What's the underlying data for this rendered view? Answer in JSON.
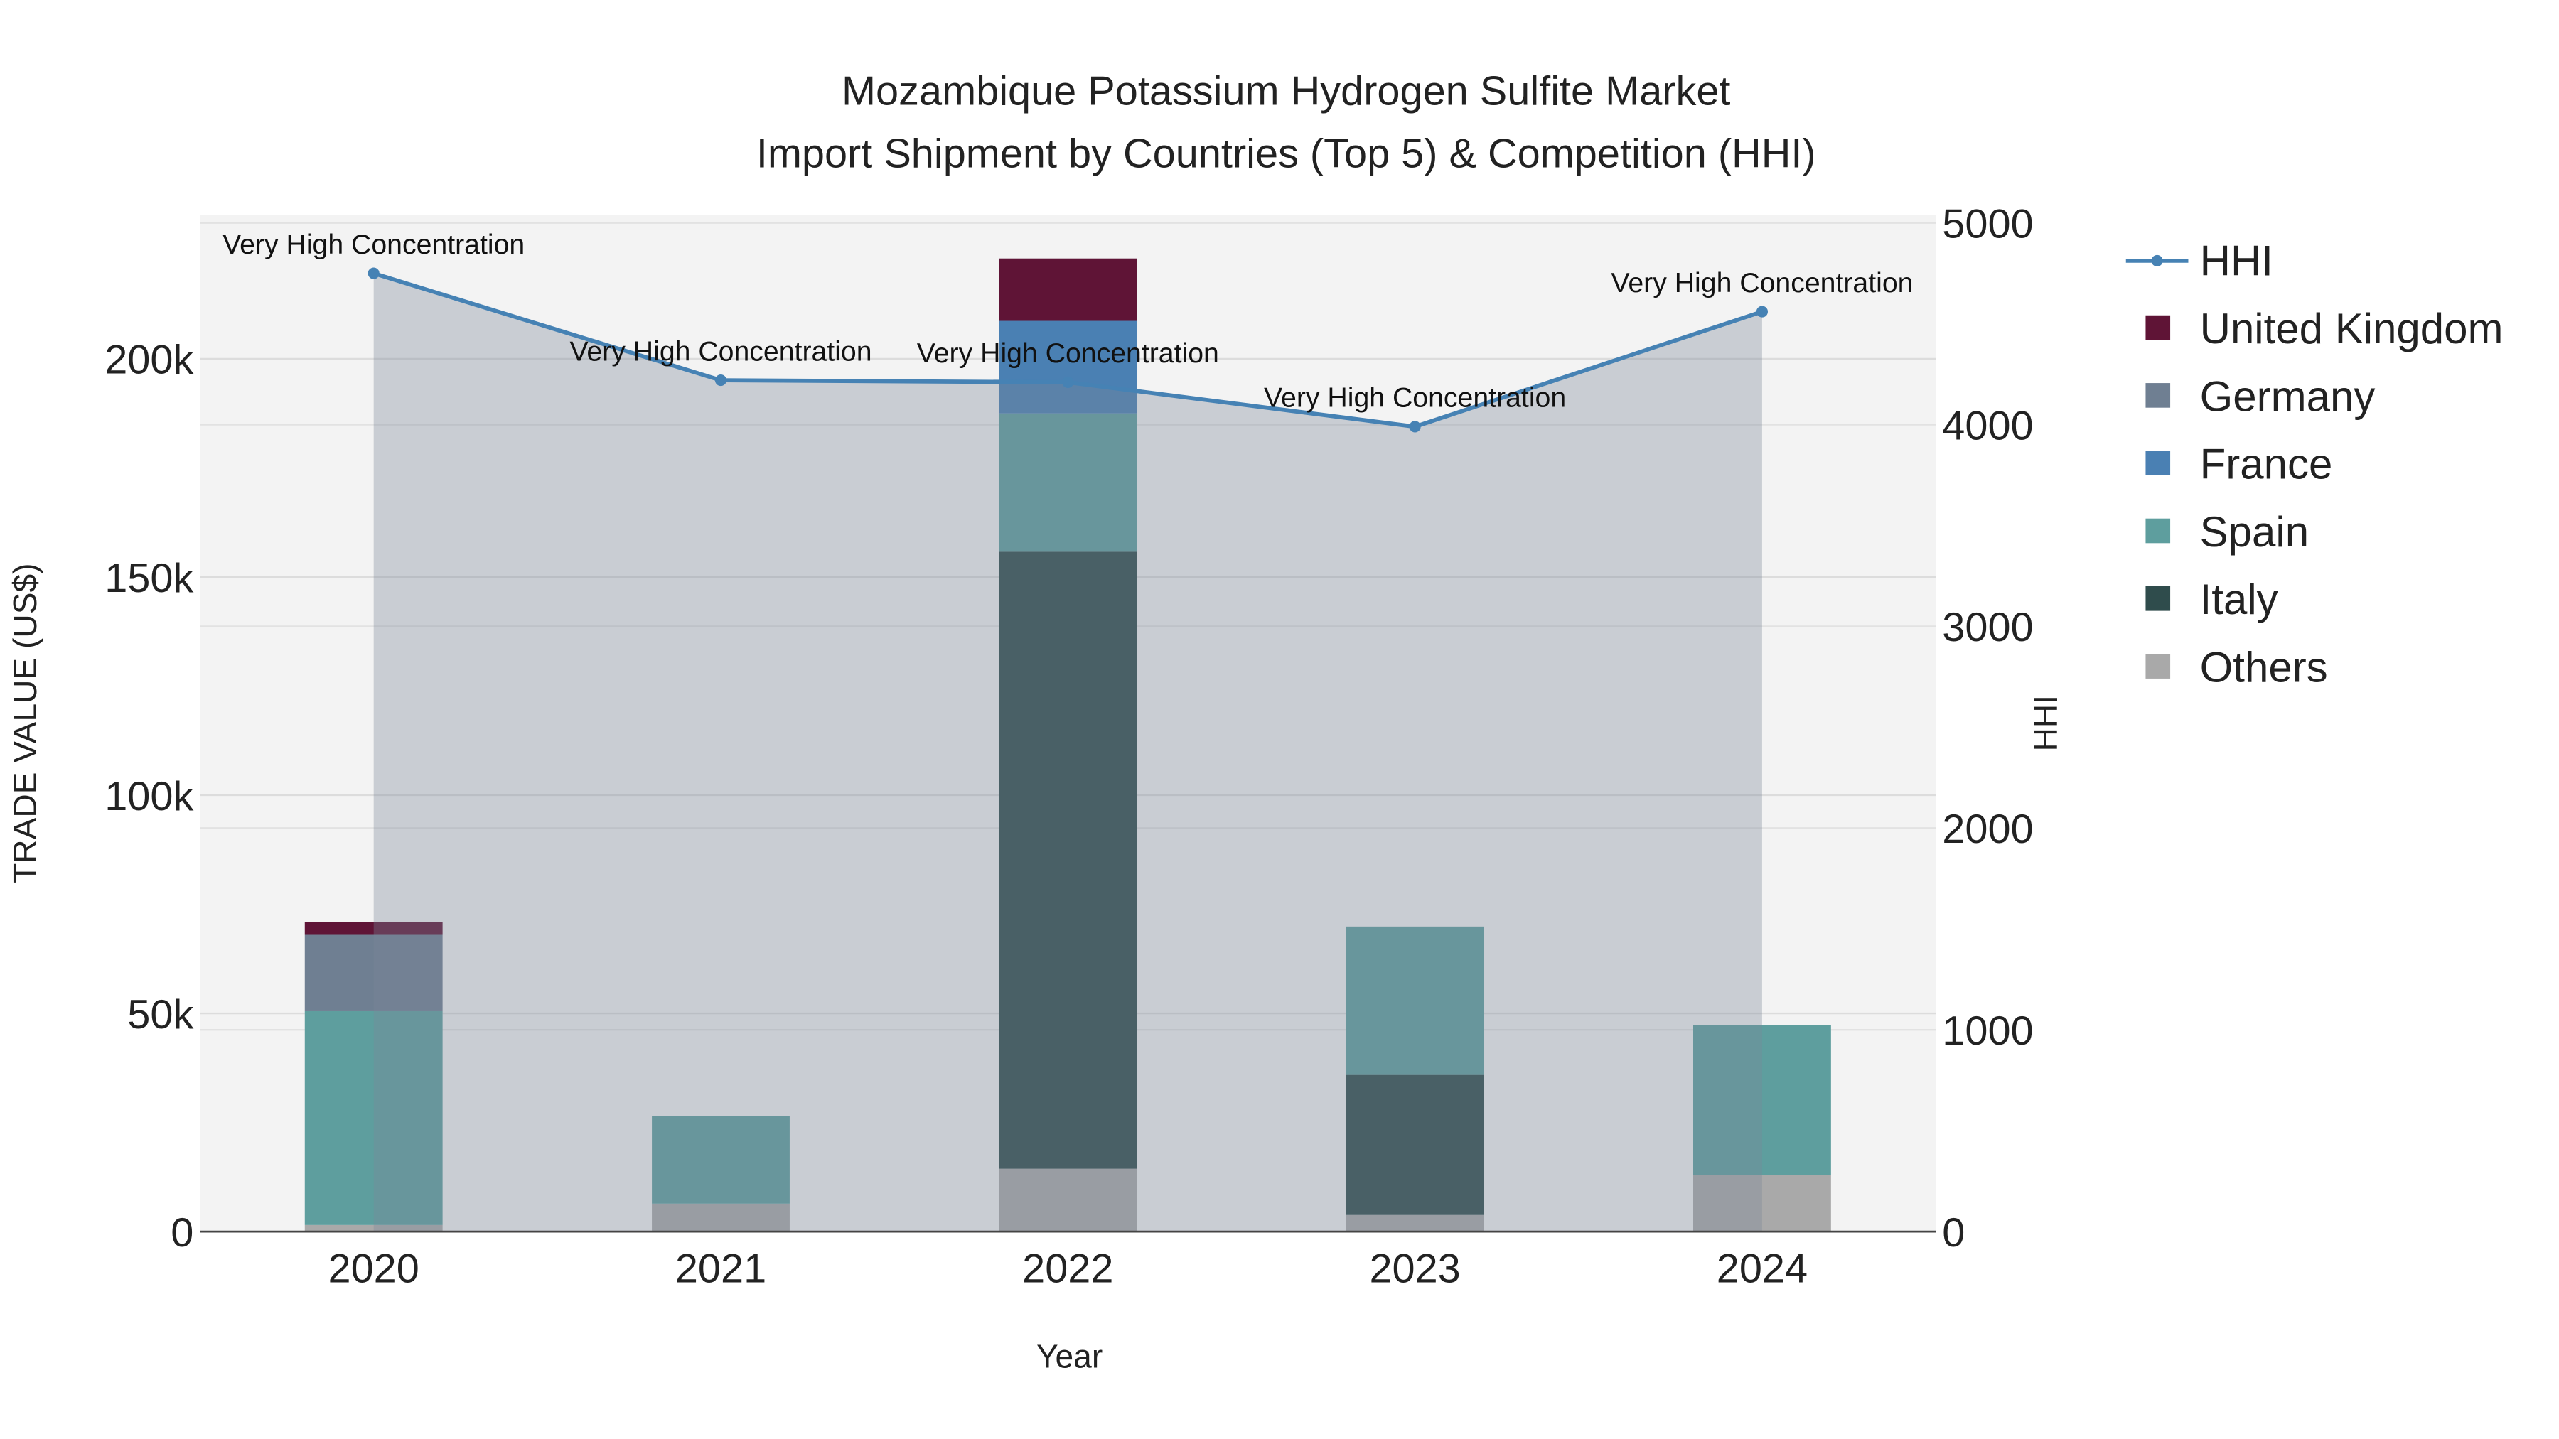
{
  "chart_data": {
    "type": "bar",
    "title_line1": "Mozambique Potassium Hydrogen Sulfite Market",
    "title_line2": "Import Shipment by Countries (Top 5) & Competition (HHI)",
    "xlabel": "Year",
    "ylabel": "TRADE VALUE (US$)",
    "y2label": "HHI",
    "categories": [
      "2020",
      "2021",
      "2022",
      "2023",
      "2024"
    ],
    "ylim": [
      0,
      233000
    ],
    "y2lim": [
      0,
      5040
    ],
    "yticks": [
      0,
      50000,
      100000,
      150000,
      200000
    ],
    "ytick_labels": [
      "0",
      "50k",
      "100k",
      "150k",
      "200k"
    ],
    "y2ticks": [
      0,
      1000,
      2000,
      3000,
      4000,
      5000
    ],
    "y2tick_labels": [
      "0",
      "1000",
      "2000",
      "3000",
      "4000",
      "5000"
    ],
    "grid": true,
    "legend_position": "right",
    "stack_order": [
      "Others",
      "Italy",
      "Spain",
      "France",
      "Germany",
      "United Kingdom"
    ],
    "series": [
      {
        "name": "United Kingdom",
        "color": "#5f1436",
        "values": [
          3000,
          0,
          14300,
          0,
          0
        ]
      },
      {
        "name": "Germany",
        "color": "#6f7f92",
        "values": [
          17500,
          0,
          0,
          0,
          0
        ]
      },
      {
        "name": "France",
        "color": "#4a80b3",
        "values": [
          0,
          0,
          21200,
          0,
          0
        ]
      },
      {
        "name": "Spain",
        "color": "#5e9e9e",
        "values": [
          49000,
          20000,
          31700,
          34000,
          34400
        ]
      },
      {
        "name": "Italy",
        "color": "#2f4c4c",
        "values": [
          0,
          0,
          141400,
          32100,
          0
        ]
      },
      {
        "name": "Others",
        "color": "#a9a9a9",
        "values": [
          1500,
          6400,
          14400,
          3800,
          12900
        ]
      }
    ],
    "hhi": {
      "name": "HHI",
      "color": "#4682b4",
      "values": [
        4750,
        4220,
        4210,
        3990,
        4560
      ],
      "annotations": [
        "Very High Concentration",
        "Very High Concentration",
        "Very High Concentration",
        "Very High Concentration",
        "Very High Concentration"
      ]
    }
  }
}
